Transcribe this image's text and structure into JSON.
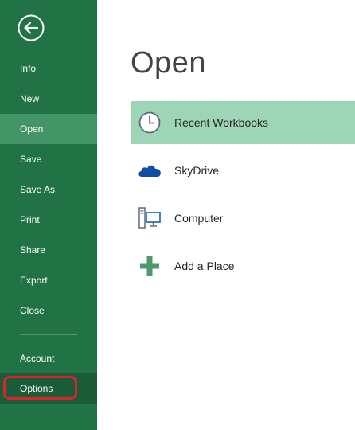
{
  "sidebar": {
    "items": [
      {
        "label": "Info"
      },
      {
        "label": "New"
      },
      {
        "label": "Open"
      },
      {
        "label": "Save"
      },
      {
        "label": "Save As"
      },
      {
        "label": "Print"
      },
      {
        "label": "Share"
      },
      {
        "label": "Export"
      },
      {
        "label": "Close"
      },
      {
        "label": "Account"
      },
      {
        "label": "Options"
      }
    ],
    "selected": "Open"
  },
  "main": {
    "title": "Open",
    "places": [
      {
        "label": "Recent Workbooks",
        "icon": "clock-icon"
      },
      {
        "label": "SkyDrive",
        "icon": "cloud-icon"
      },
      {
        "label": "Computer",
        "icon": "computer-icon"
      },
      {
        "label": "Add a Place",
        "icon": "plus-icon"
      }
    ]
  },
  "colors": {
    "sidebar": "#217346",
    "sidebar_selected": "#439467",
    "recent_selected": "#9fd5b7",
    "highlight_ring": "#e0202a"
  }
}
